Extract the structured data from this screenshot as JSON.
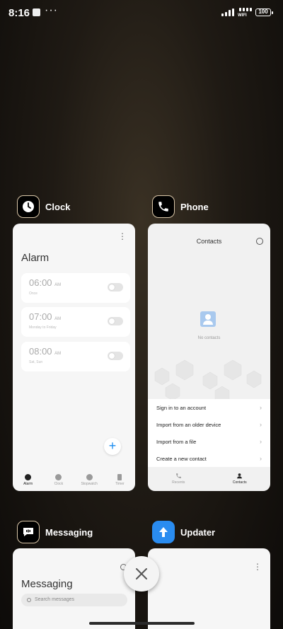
{
  "status_bar": {
    "time": "8:16",
    "dots": "···",
    "wifi": "WIFI",
    "battery": "100"
  },
  "apps": [
    {
      "name": "Clock",
      "icon": "clock-icon"
    },
    {
      "name": "Phone",
      "icon": "phone-icon"
    },
    {
      "name": "Messaging",
      "icon": "messaging-icon"
    },
    {
      "name": "Updater",
      "icon": "updater-arrow-icon"
    }
  ],
  "clock": {
    "menu": "⋮",
    "title": "Alarm",
    "alarms": [
      {
        "time": "06:00",
        "ampm": "AM",
        "sub": "Once"
      },
      {
        "time": "07:00",
        "ampm": "AM",
        "sub": "Monday to Friday"
      },
      {
        "time": "08:00",
        "ampm": "AM",
        "sub": "Sat, Sun"
      }
    ],
    "fab": "+",
    "nav": [
      "Alarm",
      "Clock",
      "Stopwatch",
      "Timer"
    ]
  },
  "phone": {
    "title": "Contacts",
    "empty": "No contacts",
    "menu": [
      "Sign in to an account",
      "Import from an older device",
      "Import from a file",
      "Create a new contact"
    ],
    "nav": [
      "Recents",
      "Contacts"
    ]
  },
  "messaging": {
    "title": "Messaging",
    "search_placeholder": "Search messages"
  },
  "updater": {
    "menu": "⋮"
  },
  "colors": {
    "accent": "#1a8cf0",
    "updater_icon": "#2a8cf0"
  }
}
